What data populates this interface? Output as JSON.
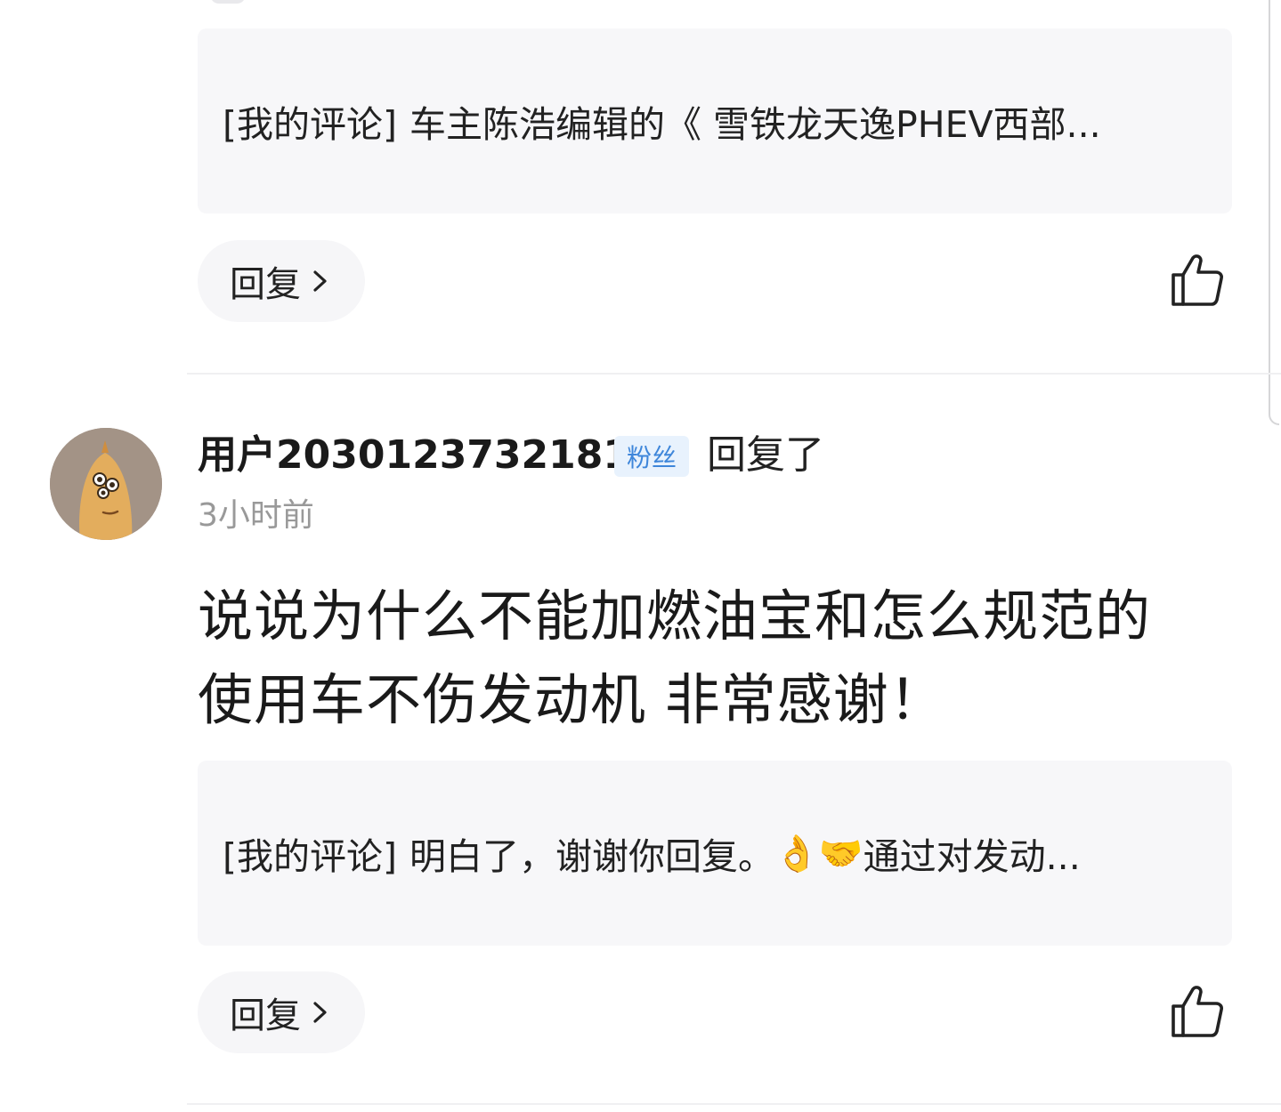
{
  "first_comment": {
    "quote": {
      "prefix": "[我的评论]",
      "text": "车主陈浩编辑的《 雪铁龙天逸PHEV西部..."
    },
    "reply_label": "回复",
    "like_icon": "thumbs-up-icon",
    "chevron_icon": "chevron-right-icon"
  },
  "second_comment": {
    "avatar_icon": "avatar-cartoon-icon",
    "username": "用户2030123732181",
    "badge": "粉丝",
    "action": "回复了",
    "timestamp": "3小时前",
    "body_line1": "说说为什么不能加燃油宝和怎么规范的",
    "body_line2": "使用车不伤发动机 非常感谢！",
    "quote": {
      "prefix": "[我的评论]",
      "text_before_emoji": "明白了，谢谢你回复。",
      "emoji1": "👌",
      "emoji2": "🤝",
      "text_after_emoji": "通过对发动..."
    },
    "reply_label": "回复",
    "like_icon": "thumbs-up-icon",
    "chevron_icon": "chevron-right-icon"
  },
  "colors": {
    "badge_bg": "#e8f2fd",
    "badge_text": "#3e86da",
    "quote_bg": "#f7f7f9",
    "timestamp": "#999999"
  }
}
